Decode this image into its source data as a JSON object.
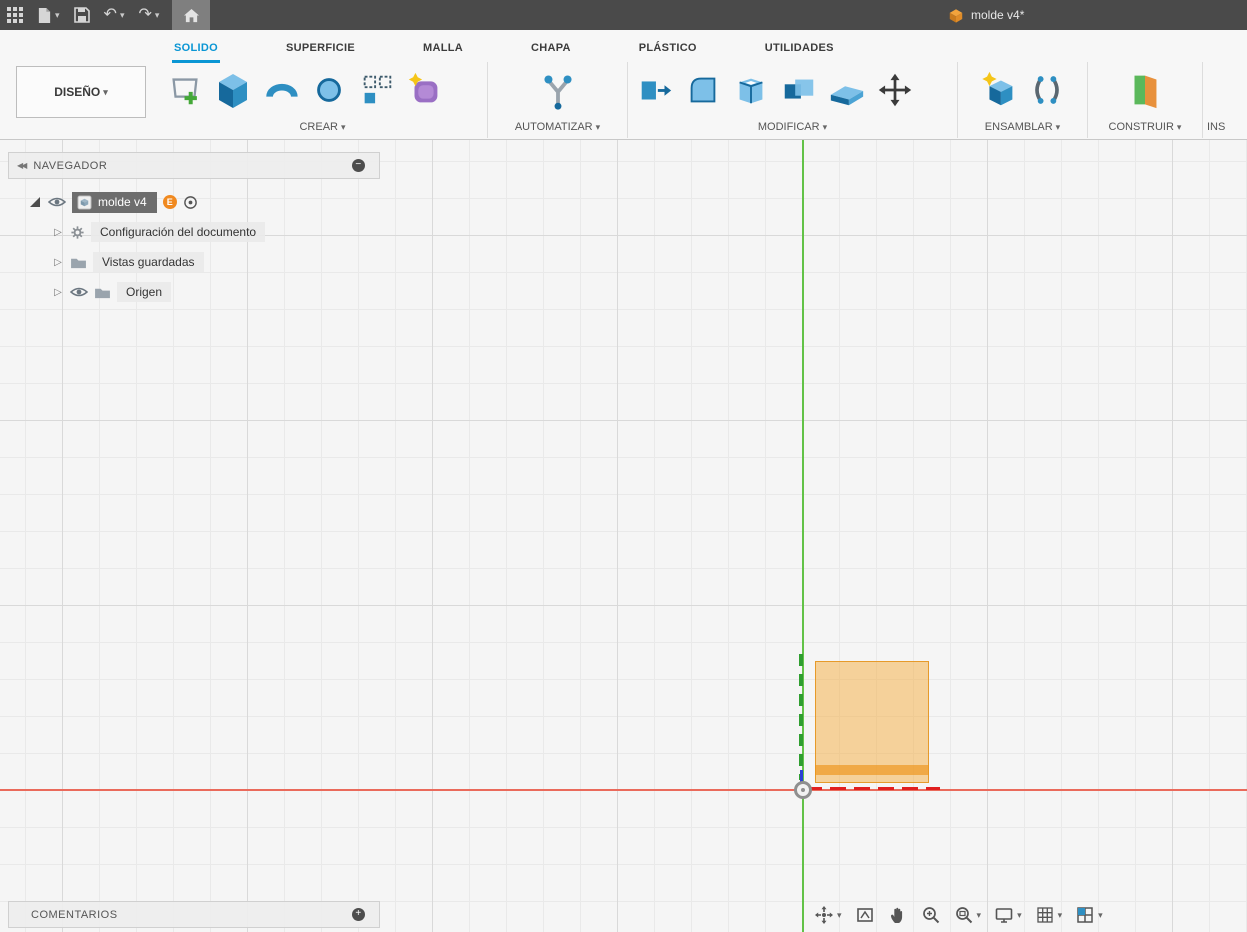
{
  "titlebar": {
    "document_title": "molde v4*"
  },
  "ribbon": {
    "design_dropdown_label": "DISEÑO",
    "active_tab": "SOLIDO",
    "tabs": [
      {
        "label": "SOLIDO"
      },
      {
        "label": "SUPERFICIE"
      },
      {
        "label": "MALLA"
      },
      {
        "label": "CHAPA"
      },
      {
        "label": "PLÁSTICO"
      },
      {
        "label": "UTILIDADES"
      }
    ],
    "groups": {
      "crear": "CREAR",
      "automatizar": "AUTOMATIZAR",
      "modificar": "MODIFICAR",
      "ensamblar": "ENSAMBLAR",
      "construir": "CONSTRUIR",
      "inspeccionar_truncated": "INS"
    },
    "tool_icons": {
      "crear": [
        "create-sketch-icon",
        "extrude-icon",
        "revolve-icon",
        "cylinder-icon",
        "pattern-icon",
        "create-form-icon"
      ],
      "automatizar": [
        "automated-modeling-icon"
      ],
      "modificar": [
        "press-pull-icon",
        "fillet-icon",
        "shell-icon",
        "combine-icon",
        "offset-face-icon",
        "move-copy-icon"
      ],
      "ensamblar": [
        "new-component-icon",
        "joint-icon"
      ],
      "construir": [
        "construction-plane-icon"
      ]
    }
  },
  "navigator": {
    "title": "NAVEGADOR",
    "root": {
      "label": "molde v4",
      "badge": "E"
    },
    "items": [
      {
        "label": "Configuración del documento"
      },
      {
        "label": "Vistas guardadas"
      },
      {
        "label": "Origen"
      }
    ]
  },
  "comments_panel": {
    "title": "COMENTARIOS"
  },
  "nav_toolbar": {
    "buttons": [
      "orbit",
      "look-at",
      "pan",
      "zoom",
      "fit",
      "display-settings",
      "grid-snaps",
      "viewports"
    ]
  },
  "colors": {
    "accent_blue": "#0a96d4",
    "axis_x_red": "#ea6a5b",
    "axis_y_green": "#62c247",
    "sketch_orange": "#f7a62c",
    "titlebar_bg": "#4a4a4a"
  }
}
